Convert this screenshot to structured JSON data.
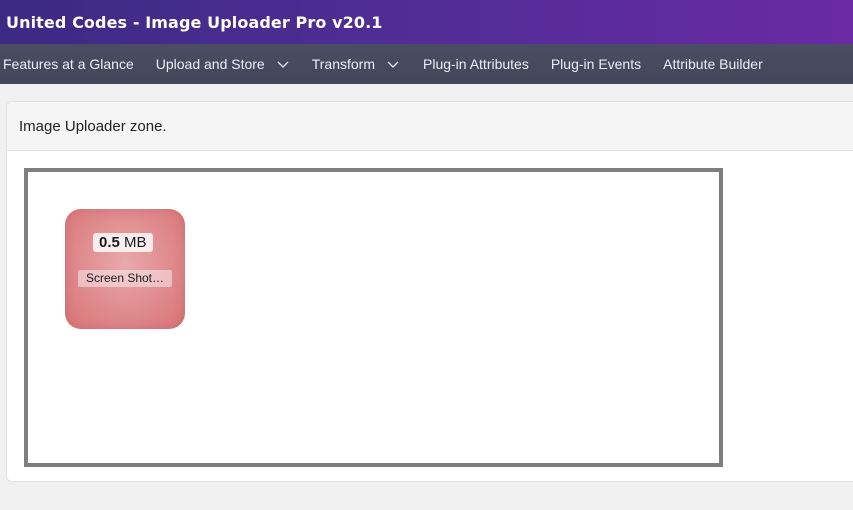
{
  "header": {
    "title": "United Codes - Image Uploader Pro v20.1"
  },
  "nav": {
    "items": [
      {
        "label": "Features at a Glance",
        "has_dropdown": false
      },
      {
        "label": "Upload and Store",
        "has_dropdown": true
      },
      {
        "label": "Transform",
        "has_dropdown": true
      },
      {
        "label": "Plug-in Attributes",
        "has_dropdown": false
      },
      {
        "label": "Plug-in Events",
        "has_dropdown": false
      },
      {
        "label": "Attribute Builder",
        "has_dropdown": false
      }
    ],
    "dropdown_icon": "chevron-down-icon"
  },
  "region": {
    "title": "Image Uploader zone."
  },
  "uploader": {
    "file": {
      "size_value": "0.5",
      "size_unit": "MB",
      "name": "Screen Shot…"
    }
  },
  "colors": {
    "header_gradient_start": "#3b2a83",
    "header_gradient_end": "#6a2aa3",
    "nav_background": "#474a5f",
    "dropzone_border": "#7f7f7f",
    "file_tile": "#df8a8d"
  }
}
